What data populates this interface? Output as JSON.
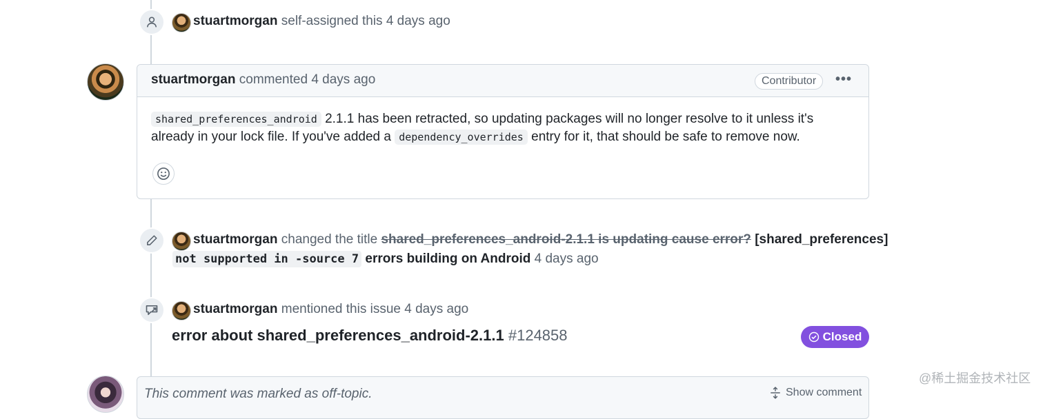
{
  "event_assign": {
    "author": "stuartmorgan",
    "action": "self-assigned this",
    "time": "4 days ago"
  },
  "comment": {
    "author": "stuartmorgan",
    "action": "commented",
    "time": "4 days ago",
    "role_badge": "Contributor",
    "menu_icon": "kebab-horizontal-icon",
    "body": {
      "code1": "shared_preferences_android",
      "text1": " 2.1.1 has been retracted, so updating packages will no longer resolve to it unless it's already in your lock file. If you've added a ",
      "code2": "dependency_overrides",
      "text2": " entry for it, that should be safe to remove now."
    },
    "reaction_icon": "smiley-icon"
  },
  "event_rename": {
    "author": "stuartmorgan",
    "action": "changed the title",
    "old_title": "shared_preferences_android-2.1.1 is updating cause error?",
    "new_title_part1": "[shared_preferences]",
    "new_title_code": "not supported in -source 7",
    "new_title_part2": "errors building on Android",
    "time": "4 days ago"
  },
  "event_mention": {
    "author": "stuartmorgan",
    "action": "mentioned this issue",
    "time": "4 days ago",
    "issue_title": "error about shared_preferences_android-2.1.1",
    "issue_number": "#124858",
    "status": "Closed",
    "status_color": "#8250df"
  },
  "offtopic": {
    "message": "This comment was marked as off-topic.",
    "show_label": "Show comment"
  },
  "watermark": "@稀土掘金技术社区"
}
